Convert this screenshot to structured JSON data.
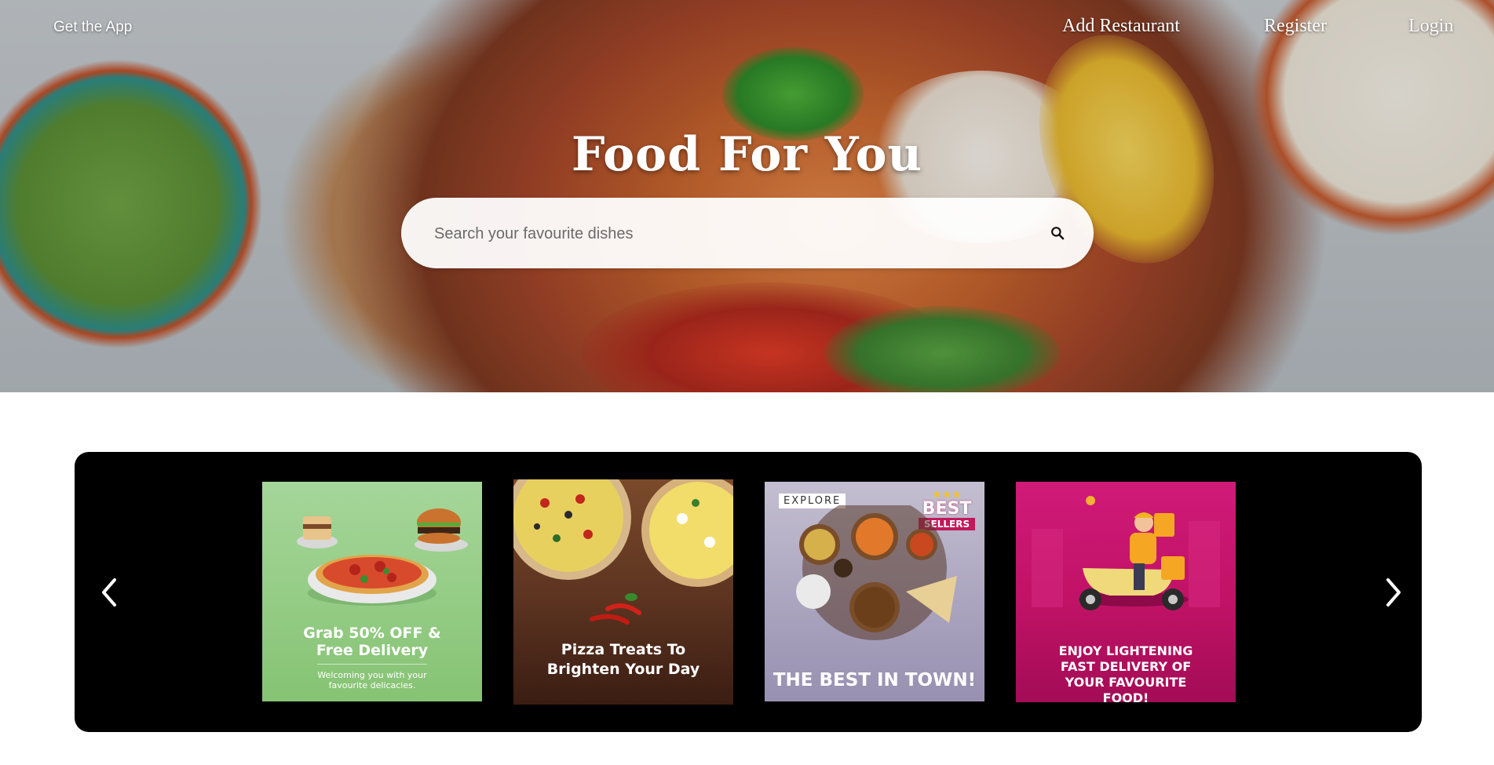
{
  "nav": {
    "get_app": "Get the App",
    "add_restaurant": "Add Restaurant",
    "register": "Register",
    "login": "Login"
  },
  "hero": {
    "title": "Food For You",
    "search_placeholder": "Search your favourite dishes"
  },
  "carousel": {
    "cards": [
      {
        "headline": "Grab 50% OFF & Free Delivery",
        "subline": "Welcoming you with your favourite delicacies."
      },
      {
        "headline": "Pizza Treats To Brighten Your Day"
      },
      {
        "tag": "EXPLORE",
        "badge_top": "BEST",
        "badge_bottom": "SELLERS",
        "headline": "THE BEST IN TOWN!"
      },
      {
        "headline": "ENJOY LIGHTENING FAST DELIVERY OF YOUR FAVOURITE FOOD!"
      }
    ]
  },
  "colors": {
    "carousel_bg": "#000000",
    "card1_bg": "#8fcb7f",
    "card2_bg": "#5b3320",
    "card3_bg": "#a8a2bd",
    "card4_bg": "#c01266"
  },
  "icons": {
    "search": "search-icon",
    "prev": "chevron-left-icon",
    "next": "chevron-right-icon"
  }
}
